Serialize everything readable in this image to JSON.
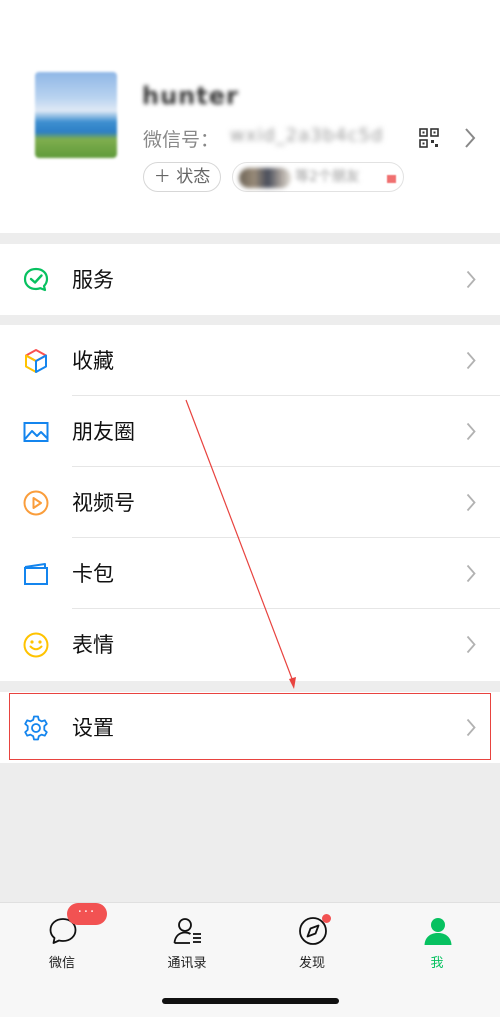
{
  "profile": {
    "nickname": "hunter",
    "wechat_id_label": "微信号：",
    "wechat_id_value": "wxid_2a3b4c5d",
    "status_button": "＋ 状态",
    "friends_status_text": "等2个朋友",
    "qr_icon": "qr-code-icon",
    "chevron_icon": "chevron-right-icon"
  },
  "menu": {
    "service": {
      "label": "服务",
      "icon": "service-icon",
      "color": "#07c160"
    },
    "favorites": {
      "label": "收藏",
      "icon": "favorites-cube-icon"
    },
    "moments": {
      "label": "朋友圈",
      "icon": "image-icon",
      "color": "#1485ee"
    },
    "channels": {
      "label": "视频号",
      "icon": "play-icon",
      "color": "#fa9d3b"
    },
    "cards": {
      "label": "卡包",
      "icon": "wallet-icon",
      "color": "#1485ee"
    },
    "stickers": {
      "label": "表情",
      "icon": "smiley-icon",
      "color": "#ffc300"
    },
    "settings": {
      "label": "设置",
      "icon": "gear-icon",
      "color": "#1485ee"
    }
  },
  "annotation": {
    "highlight_color": "#e8433f"
  },
  "tabs": [
    {
      "label": "微信",
      "icon": "chat-bubble-icon",
      "badge": "···"
    },
    {
      "label": "通讯录",
      "icon": "contacts-icon"
    },
    {
      "label": "发现",
      "icon": "compass-icon"
    },
    {
      "label": "我",
      "icon": "person-icon",
      "active": true
    }
  ],
  "colors": {
    "accent": "#07c160",
    "badge": "#f25252"
  }
}
